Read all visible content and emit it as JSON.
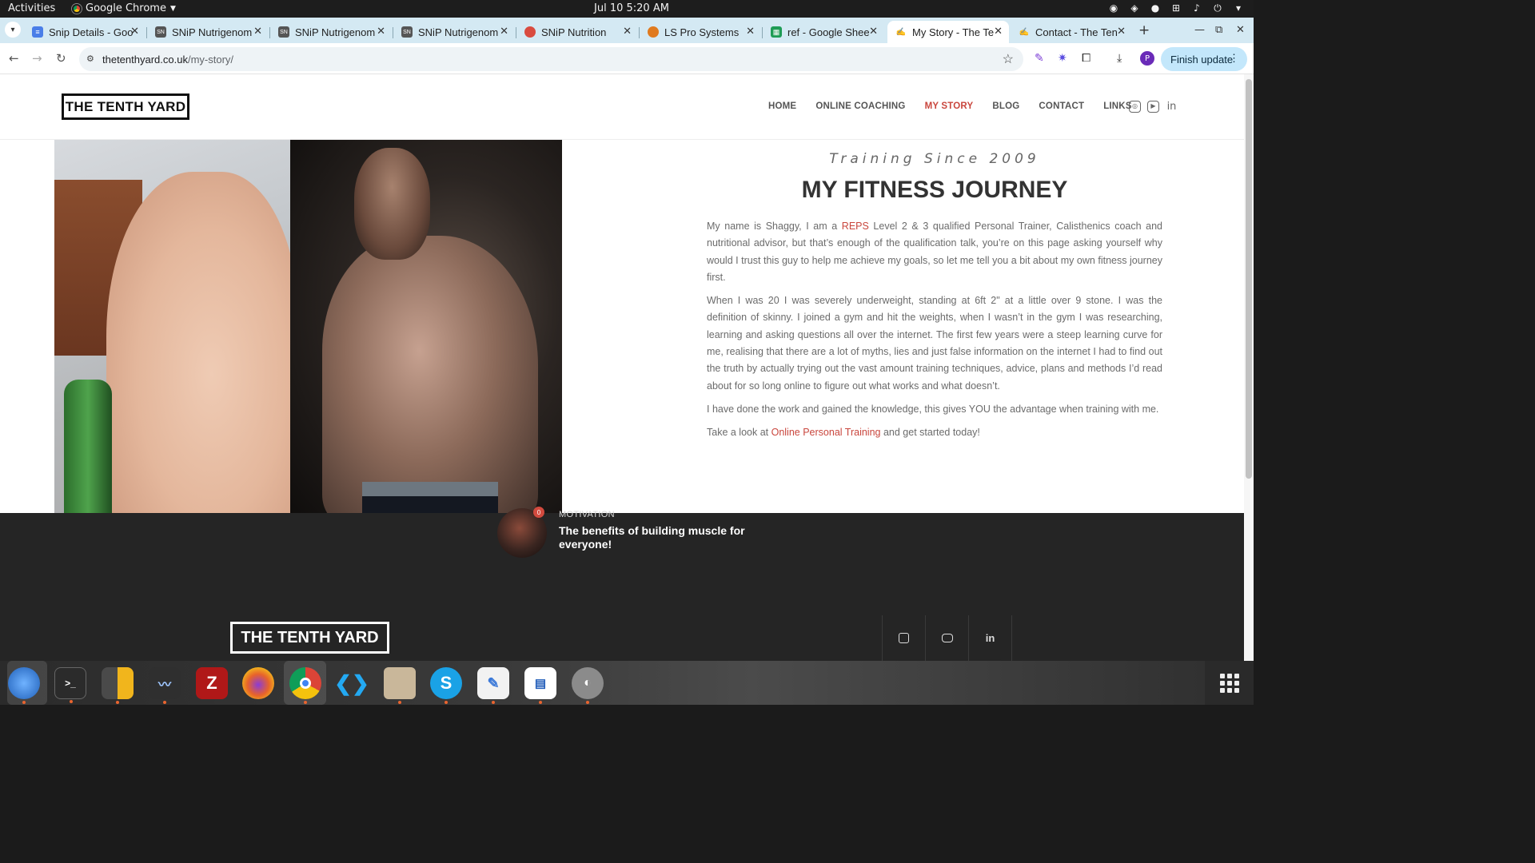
{
  "system": {
    "activities": "Activities",
    "app_menu": "Google Chrome",
    "clock": "Jul 10  5:20 AM"
  },
  "tabs": [
    {
      "label": "Snip Details - Goo",
      "icon": "docs-icon"
    },
    {
      "label": "SNiP Nutrigenom",
      "icon": "snip-icon"
    },
    {
      "label": "SNiP Nutrigenom",
      "icon": "snip-icon"
    },
    {
      "label": "SNiP Nutrigenom",
      "icon": "snip-icon"
    },
    {
      "label": "SNiP Nutrition",
      "icon": "snip-nutrition-icon"
    },
    {
      "label": "LS Pro Systems",
      "icon": "ls-icon"
    },
    {
      "label": "ref - Google Shee",
      "icon": "sheets-icon"
    },
    {
      "label": "My Story - The Te",
      "icon": "tenthyard-icon",
      "active": true
    },
    {
      "label": "Contact - The Ten",
      "icon": "tenthyard-icon"
    }
  ],
  "toolbar": {
    "url_host": "thetenthyard.co.uk",
    "url_path": "/my-story/",
    "finish_update": "Finish update",
    "profile_initial": "P"
  },
  "site": {
    "logo": "THE TENTH YARD",
    "nav": [
      "HOME",
      "ONLINE COACHING",
      "MY STORY",
      "BLOG",
      "CONTACT",
      "LINKS"
    ],
    "active_nav": "MY STORY",
    "tagline": "Training Since 2009",
    "heading": "MY FITNESS JOURNEY",
    "p1_before": "My name is Shaggy, I am a ",
    "p1_link": "REPS",
    "p1_after": " Level 2 & 3 qualified Personal Trainer, Calisthenics coach and nutritional advisor, but that’s enough of the qualification talk, you’re on this page asking yourself why would I trust this guy to help me achieve my goals, so let me tell you a bit about my own fitness journey first.",
    "p2": "When I was 20 I was severely underweight, standing at 6ft 2\" at a little over 9 stone. I was the definition of skinny. I joined a gym and hit the weights, when I wasn’t in the gym I was researching, learning and asking questions all over the internet. The first few years were a steep learning curve for me, realising that there are a lot of myths, lies and just false information on the internet I had to find out the truth by actually trying out the vast amount training techniques, advice, plans and methods I’d read about for so long online to figure out what works and what doesn’t.",
    "p3": "I have done the work and gained the knowledge, this gives YOU the advantage when training with me.",
    "p4_before": "Take a look at ",
    "p4_link": "Online Personal Training",
    "p4_after": " and get started today!",
    "post_badge": "0",
    "post_category": "MOTIVATION",
    "post_title": "The benefits of building muscle for everyone!",
    "footer_logo": "THE TENTH YARD"
  },
  "colors": {
    "accent": "#c9463d",
    "tabstrip": "#d4e9f3",
    "footer": "#252525"
  }
}
